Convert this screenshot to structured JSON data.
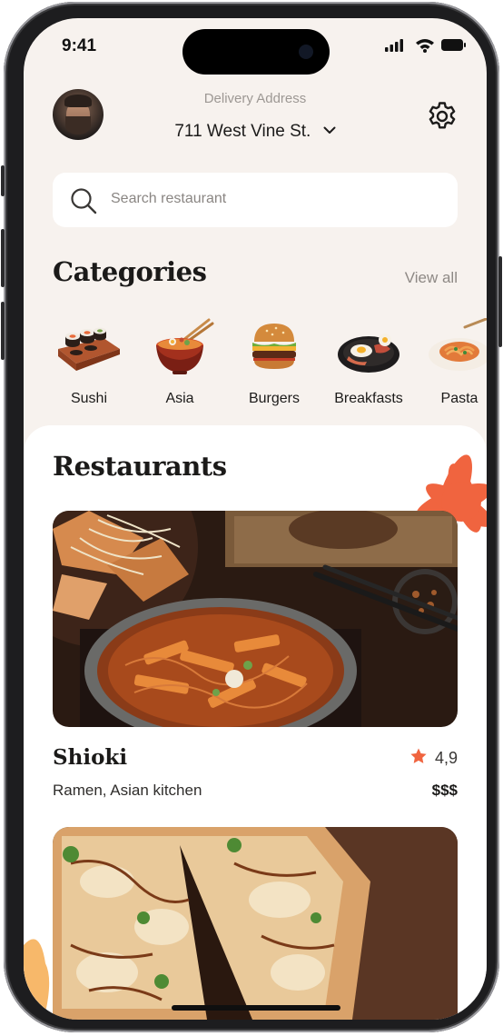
{
  "status_bar": {
    "time": "9:41"
  },
  "header": {
    "delivery_label": "Delivery Address",
    "address": "711 West Vine St."
  },
  "search": {
    "placeholder": "Search restaurant"
  },
  "categories": {
    "title": "Categories",
    "view_all": "View all",
    "items": [
      {
        "label": "Sushi",
        "icon": "sushi-icon"
      },
      {
        "label": "Asia",
        "icon": "noodle-bowl-icon"
      },
      {
        "label": "Burgers",
        "icon": "burger-icon"
      },
      {
        "label": "Breakfasts",
        "icon": "breakfast-plate-icon"
      },
      {
        "label": "Pasta",
        "icon": "pasta-plate-icon"
      }
    ]
  },
  "restaurants": {
    "title": "Restaurants",
    "items": [
      {
        "name": "Shioki",
        "rating": "4,9",
        "cuisine": "Ramen, Asian kitchen",
        "price": "$$$"
      }
    ]
  },
  "colors": {
    "accent": "#f0643f",
    "background": "#f7f2ee",
    "text": "#1b1a19"
  }
}
